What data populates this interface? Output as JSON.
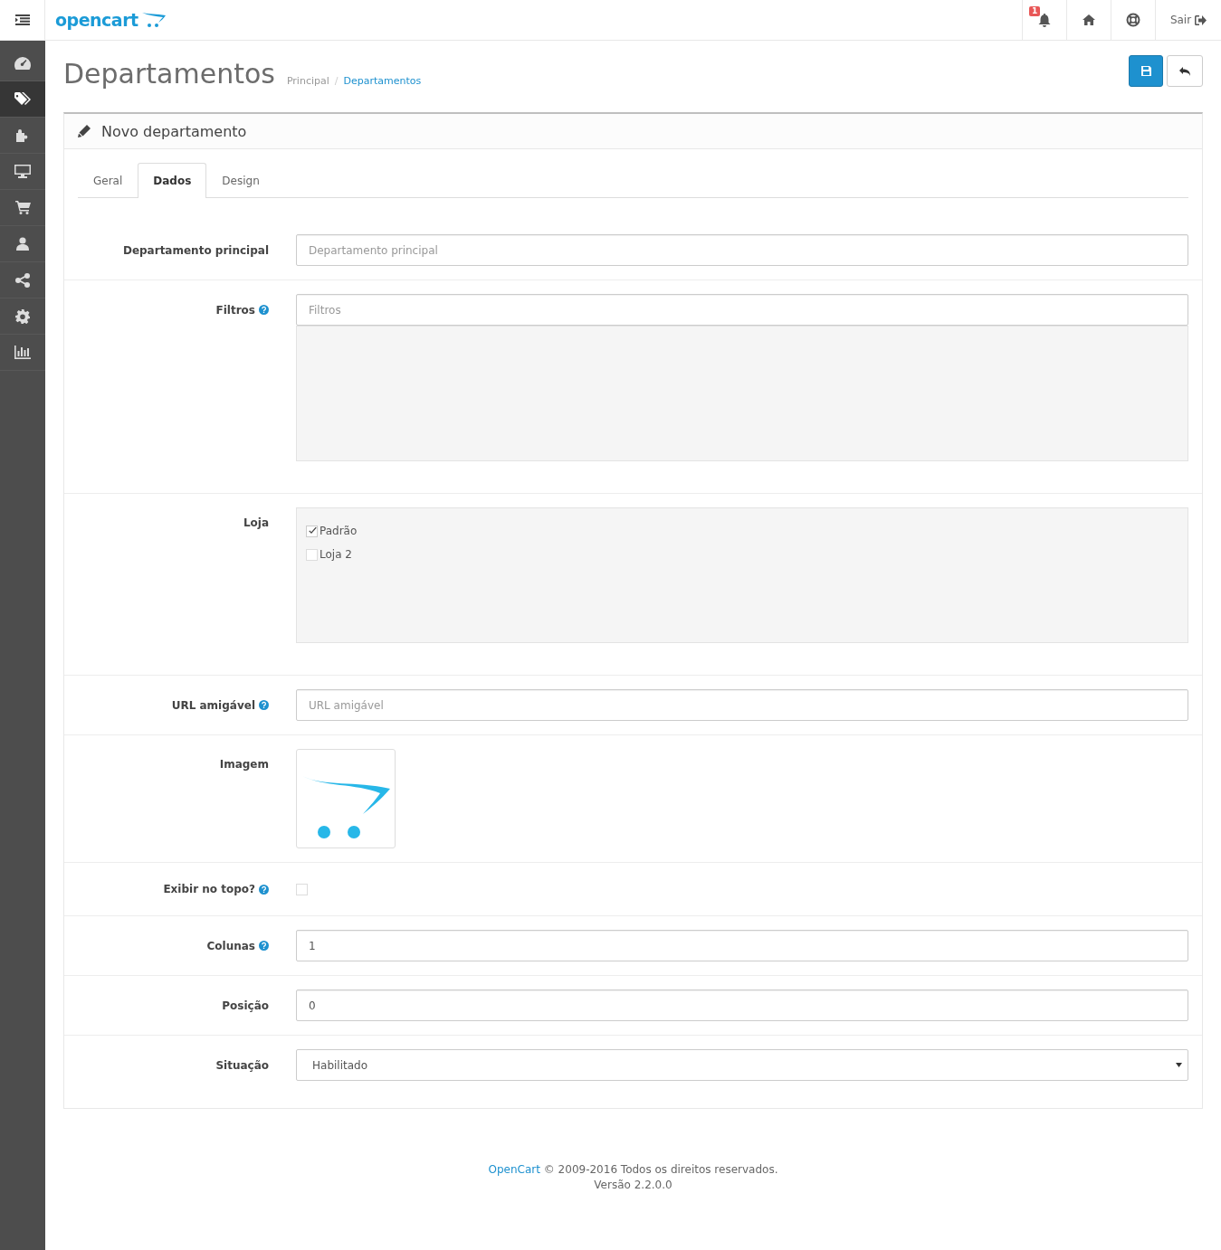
{
  "header": {
    "logo": "opencart",
    "notification_count": "1",
    "logout": "Sair"
  },
  "sidebar": {
    "items": [
      {
        "kind": "dashboard",
        "selected": false
      },
      {
        "kind": "tags",
        "selected": true
      },
      {
        "kind": "puzzle",
        "selected": false
      },
      {
        "kind": "monitor",
        "selected": false
      },
      {
        "kind": "cart",
        "selected": false
      },
      {
        "kind": "user",
        "selected": false
      },
      {
        "kind": "share",
        "selected": false
      },
      {
        "kind": "gear",
        "selected": false
      },
      {
        "kind": "chart",
        "selected": false
      }
    ]
  },
  "page": {
    "title": "Departamentos",
    "breadcrumb_separator": "/",
    "breadcrumb": [
      {
        "label": "Principal",
        "selected": false
      },
      {
        "label": "Departamentos",
        "selected": true
      }
    ]
  },
  "panel": {
    "title": "Novo departamento",
    "tabs": [
      {
        "label": "Geral",
        "selected": false
      },
      {
        "label": "Dados",
        "selected": true
      },
      {
        "label": "Design",
        "selected": false
      }
    ],
    "fields": [
      {
        "kind": "text",
        "label": "Departamento principal",
        "help": false,
        "placeholder": "Departamento principal"
      },
      {
        "kind": "autocomplete",
        "label": "Filtros",
        "help": true,
        "placeholder": "Filtros"
      },
      {
        "kind": "checklist",
        "label": "Loja",
        "help": false,
        "options": [
          {
            "label": "Padrão",
            "checked": true
          },
          {
            "label": "Loja 2",
            "checked": false
          }
        ]
      },
      {
        "kind": "text",
        "label": "URL amigável",
        "help": true,
        "placeholder": "URL amigável"
      },
      {
        "kind": "image",
        "label": "Imagem",
        "help": false
      },
      {
        "kind": "checkbox",
        "label": "Exibir no topo?",
        "help": true,
        "checked": false
      },
      {
        "kind": "text",
        "label": "Colunas",
        "help": true,
        "value": "1"
      },
      {
        "kind": "text",
        "label": "Posição",
        "help": false,
        "value": "0"
      },
      {
        "kind": "select",
        "label": "Situação",
        "help": false,
        "value": "Habilitado"
      }
    ]
  },
  "footer": {
    "link": "OpenCart",
    "text": "© 2009-2016 Todos os direitos reservados.",
    "version": "Versão 2.2.0.0"
  }
}
